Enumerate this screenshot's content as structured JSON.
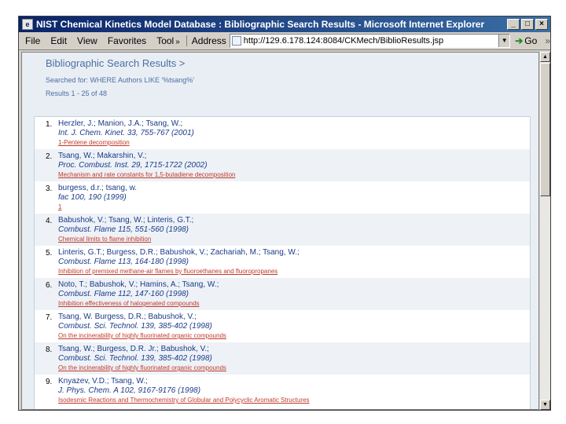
{
  "window": {
    "title": "NIST Chemical Kinetics Model Database : Bibliographic Search Results - Microsoft Internet Explorer",
    "icon": "ie-icon",
    "controls": [
      "_",
      "□",
      "×"
    ]
  },
  "toolbar": {
    "menu": [
      "File",
      "Edit",
      "View",
      "Favorites",
      "Tool"
    ],
    "chevron": "»",
    "address_label": "Address",
    "address_url": "http://129.6.178.124:8084/CKMech/BiblioResults.jsp",
    "go_label": "Go",
    "links_label": "»"
  },
  "page": {
    "title": "Bibliographic Search Results >",
    "search_line": "Searched for: WHERE Authors LIKE '%tsang%'",
    "range_line": "Results 1 - 25 of 48"
  },
  "results": [
    {
      "num": "1.",
      "authors": "Herzler, J.; Manion, J.A.; Tsang, W.;",
      "journal": "Int. J. Chem. Kinet. 33, 755-767 (2001)",
      "title": "1-Pentene decomposition"
    },
    {
      "num": "2.",
      "authors": "Tsang, W.; Makarshin, V.;",
      "journal": "Proc. Combust. Inst. 29, 1715-1722 (2002)",
      "title": "Mechanism and rate constants for 1,5-butadiene decomposition"
    },
    {
      "num": "3.",
      "authors": "burgess, d.r.; tsang, w.",
      "journal": "fac 100, 190 (1999)",
      "title": "1"
    },
    {
      "num": "4.",
      "authors": "Babushok, V.; Tsang, W.; Linteris, G.T.;",
      "journal": "Combust. Flame 115, 551-560 (1998)",
      "title": "Chemical limits to flame inhibition"
    },
    {
      "num": "5.",
      "authors": "Linteris, G.T.; Burgess, D.R.; Babushok, V.; Zachariah, M.; Tsang, W.;",
      "journal": "Combust. Flame 113, 164-180 (1998)",
      "title": "Inhibition of premixed methane-air flames by fluoroethanes and fluoropropanes"
    },
    {
      "num": "6.",
      "authors": "Noto, T.; Babushok, V.; Hamins, A.; Tsang, W.;",
      "journal": "Combust. Flame 112, 147-160 (1998)",
      "title": "Inhibition effectiveness of halogenated compounds"
    },
    {
      "num": "7.",
      "authors": "Tsang, W. Burgess, D.R.; Babushok, V.;",
      "journal": "Combust. Sci. Technol. 139, 385-402 (1998)",
      "title": "On the incinerability of highly fluorinated organic compounds"
    },
    {
      "num": "8.",
      "authors": "Tsang, W.; Burgess, D.R. Jr.; Babushok, V.;",
      "journal": "Combust. Sci. Technol. 139, 385-402 (1998)",
      "title": "On the incinerability of highly fluorinated organic compounds"
    },
    {
      "num": "9.",
      "authors": "Knyazev, V.D.; Tsang, W.;",
      "journal": "J. Phys. Chem. A 102, 9167-9176 (1998)",
      "title": "Isodesmic Reactions and Thermochemistry of Globular and Polycyclic Aromatic Structures"
    }
  ]
}
